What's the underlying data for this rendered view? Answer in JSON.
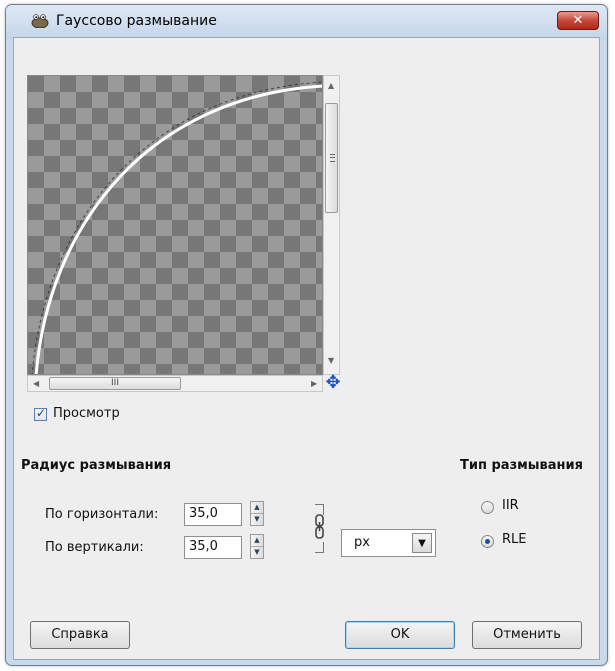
{
  "window": {
    "title": "Гауссово размывание",
    "close_glyph": "✕",
    "icon": "gimp-wilber-icon"
  },
  "preview": {
    "checkbox_label": "Просмотр",
    "checked": true,
    "horizontal_scroll_grip": "III",
    "nav_icon": "move-icon"
  },
  "blur_radius": {
    "title": "Радиус размывания",
    "horizontal_label": "По горизонтали:",
    "horizontal_value": "35,0",
    "vertical_label": "По вертикали:",
    "vertical_value": "35,0",
    "unit": "px",
    "chain_icon": "chain-link-icon"
  },
  "blur_type": {
    "title": "Тип размывания",
    "options": [
      {
        "label": "IIR",
        "selected": false
      },
      {
        "label": "RLE",
        "selected": true
      }
    ]
  },
  "buttons": {
    "help": "Справка",
    "ok": "OK",
    "cancel": "Отменить"
  }
}
